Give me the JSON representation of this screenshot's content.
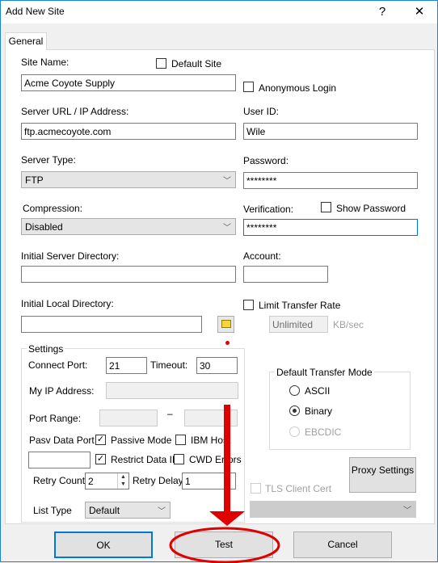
{
  "window": {
    "title": "Add New Site",
    "help": "?",
    "close": "✕"
  },
  "tabs": [
    {
      "label": "General"
    }
  ],
  "left": {
    "site_name_label": "Site Name:",
    "default_site_label": "Default Site",
    "site_name": "Acme Coyote Supply",
    "server_url_label": "Server URL / IP Address:",
    "server_url": "ftp.acmecoyote.com",
    "server_type_label": "Server Type:",
    "server_type": "FTP",
    "compression_label": "Compression:",
    "compression": "Disabled",
    "init_server_dir_label": "Initial Server Directory:",
    "init_server_dir": "",
    "init_local_dir_label": "Initial Local Directory:",
    "init_local_dir": ""
  },
  "settings": {
    "title": "Settings",
    "connect_port_label": "Connect Port:",
    "connect_port": "21",
    "timeout_label": "Timeout:",
    "timeout": "30",
    "my_ip_label": "My IP Address:",
    "port_range_label": "Port Range:",
    "port_range_sep": "–",
    "pasv_label": "Pasv Data Port",
    "passive_mode_label": "Passive Mode",
    "passive_mode": true,
    "ibm_host_label": "IBM Host",
    "ibm_host": false,
    "restrict_label": "Restrict Data IP",
    "restrict": true,
    "cwd_errors_label": "CWD Errors",
    "cwd_errors": false,
    "retry_count_label": "Retry Count",
    "retry_count": "2",
    "retry_delay_label": "Retry Delay",
    "retry_delay": "1",
    "list_type_label": "List Type",
    "list_type": "Default"
  },
  "right": {
    "anonymous_label": "Anonymous Login",
    "user_id_label": "User ID:",
    "user_id": "Wile",
    "password_label": "Password:",
    "password": "********",
    "verification_label": "Verification:",
    "verification": "********",
    "show_password_label": "Show Password",
    "account_label": "Account:",
    "account": "",
    "limit_rate_label": "Limit Transfer Rate",
    "rate": "Unlimited",
    "rate_unit": "KB/sec",
    "transfer_mode_title": "Default Transfer Mode",
    "modes": [
      {
        "label": "ASCII",
        "selected": false
      },
      {
        "label": "Binary",
        "selected": true
      },
      {
        "label": "EBCDIC",
        "selected": false,
        "disabled": true
      }
    ],
    "proxy_label": "Proxy Settings",
    "tls_label": "TLS Client Cert"
  },
  "footer": {
    "ok": "OK",
    "test": "Test",
    "cancel": "Cancel"
  },
  "annotation_color": "#e00000"
}
